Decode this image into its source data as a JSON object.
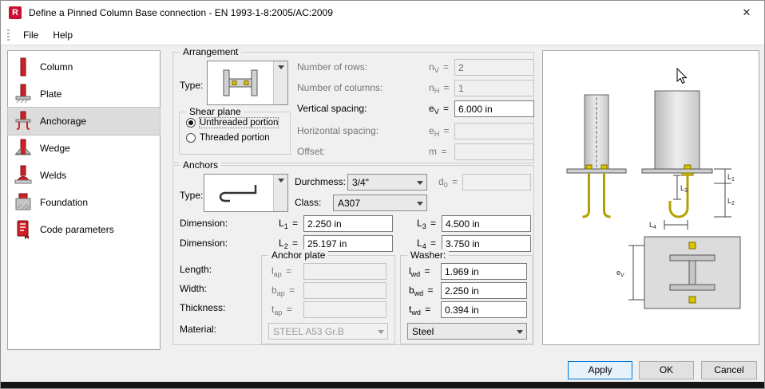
{
  "window": {
    "title": "Define a Pinned Column Base connection - EN 1993-1-8:2005/AC:2009",
    "close_glyph": "✕"
  },
  "menu": {
    "file": "File",
    "help": "Help"
  },
  "sidebar": {
    "selected": "Anchorage",
    "items": [
      {
        "label": "Column"
      },
      {
        "label": "Plate"
      },
      {
        "label": "Anchorage"
      },
      {
        "label": "Wedge"
      },
      {
        "label": "Welds"
      },
      {
        "label": "Foundation"
      },
      {
        "label": "Code parameters"
      }
    ]
  },
  "symbols": {
    "eq": "="
  },
  "arrangement": {
    "title": "Arrangement",
    "type_label": "Type:",
    "rows_label": "Number of rows:",
    "rows_sym": "n",
    "rows_sub": "V",
    "rows_value": "2",
    "cols_label": "Number of columns:",
    "cols_sym": "n",
    "cols_sub": "H",
    "cols_value": "1",
    "vsp_label": "Vertical spacing:",
    "vsp_sym": "e",
    "vsp_sub": "V",
    "vsp_value": "6.000 in",
    "hsp_label": "Horizontal spacing:",
    "hsp_sym": "e",
    "hsp_sub": "H",
    "hsp_value": "",
    "off_label": "Offset:",
    "off_sym": "m",
    "off_sub": "",
    "off_value": ""
  },
  "shear_plane": {
    "title": "Shear plane",
    "option1": "Unthreaded portion",
    "option2": "Threaded portion",
    "selected": "Unthreaded portion"
  },
  "anchors": {
    "title": "Anchors",
    "type_label": "Type:",
    "diameter_label": "Durchmess:",
    "diameter_value": "3/4\"",
    "d0_sym": "d",
    "d0_sub": "0",
    "d0_value": "",
    "class_label": "Class:",
    "class_value": "A307",
    "dim1_label": "Dimension:",
    "dim2_label": "Dimension:",
    "L1_sym": "L",
    "L1_sub": "1",
    "L1_value": "2.250 in",
    "L2_sym": "L",
    "L2_sub": "2",
    "L2_value": "25.197 in",
    "L3_sym": "L",
    "L3_sub": "3",
    "L3_value": "4.500 in",
    "L4_sym": "L",
    "L4_sub": "4",
    "L4_value": "3.750 in",
    "length_label": "Length:",
    "width_label": "Width:",
    "thickness_label": "Thickness:",
    "material_label": "Material:"
  },
  "anchor_plate": {
    "title": "Anchor plate",
    "lap_sym": "l",
    "lap_sub": "ap",
    "lap_value": "",
    "bap_sym": "b",
    "bap_sub": "ap",
    "bap_value": "",
    "tap_sym": "t",
    "tap_sub": "ap",
    "tap_value": "",
    "material_value": "STEEL A53 Gr.B"
  },
  "washer": {
    "title": "Washer:",
    "lwd_sym": "l",
    "lwd_sub": "wd",
    "lwd_value": "1.969 in",
    "bwd_sym": "b",
    "bwd_sub": "wd",
    "bwd_value": "2.250 in",
    "twd_sym": "t",
    "twd_sub": "wd",
    "twd_value": "0.394 in",
    "material_value": "Steel"
  },
  "preview": {
    "dims": {
      "L1_sym": "L",
      "L1_sub": "1",
      "L2_sym": "L",
      "L2_sub": "2",
      "L3_sym": "L",
      "L3_sub": "3",
      "L4_sym": "L",
      "L4_sub": "4",
      "eV_sym": "e",
      "eV_sub": "V"
    }
  },
  "buttons": {
    "apply": "Apply",
    "ok": "OK",
    "cancel": "Cancel"
  },
  "colors": {
    "accent": "#0078d7",
    "anchor_yellow": "#d9c400",
    "icon_red": "#cf2027",
    "dialog_bg": "#f0f0f0"
  }
}
